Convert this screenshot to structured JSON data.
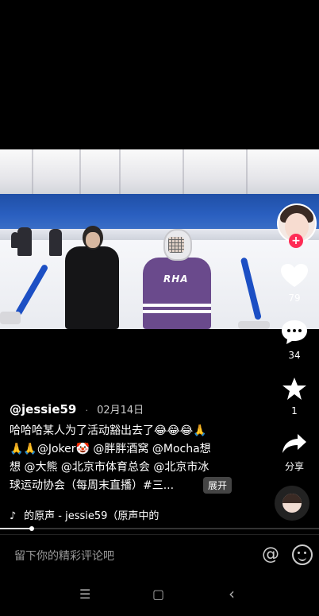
{
  "video": {
    "jersey_text": "RHA"
  },
  "rail": {
    "like_count": "79",
    "comment_count": "34",
    "favorite_count": "1",
    "share_label": "分享",
    "follow_symbol": "+"
  },
  "post": {
    "handle": "@jessie59",
    "separator": "·",
    "date": "02月14日",
    "caption_line1": "哈哈哈某人为了活动豁出去了😂😂😂🙏",
    "caption_line2": "🙏🙏@Joker🤡 @胖胖酒窝 @Mocha想",
    "caption_line3": "想 @大熊 @北京市体育总会 @北京市冰",
    "caption_line4": "球运动协会（每周末直播）#三...",
    "expand_label": "展开",
    "music_text": "的原声 - jessie59（原声中的"
  },
  "progress": {
    "fraction": 0.1
  },
  "comment": {
    "placeholder": "留下你的精彩评论吧",
    "at_symbol": "@"
  },
  "nav": {
    "menu": "☰",
    "home": "▢",
    "back": "‹"
  }
}
